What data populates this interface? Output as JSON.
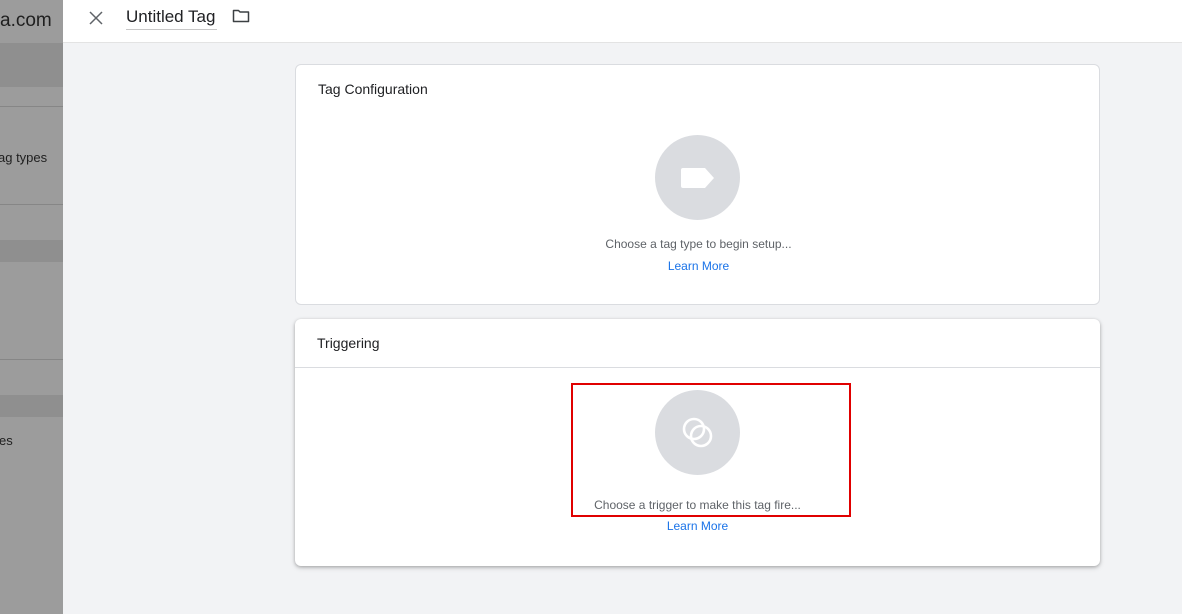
{
  "background": {
    "domain_fragment": "a.com",
    "sidebar_text_1": "ag types",
    "sidebar_text_2": "es"
  },
  "header": {
    "title": "Untitled Tag"
  },
  "tag_configuration": {
    "title": "Tag Configuration",
    "hint": "Choose a tag type to begin setup...",
    "learn_more": "Learn More"
  },
  "triggering": {
    "title": "Triggering",
    "hint": "Choose a trigger to make this tag fire...",
    "learn_more": "Learn More"
  },
  "icons": {
    "close": "close-icon",
    "folder": "folder-icon",
    "tag": "tag-icon",
    "trigger": "trigger-icon"
  },
  "colors": {
    "accent": "#1a73e8",
    "highlight": "#e00000",
    "icon_circle": "#dadce0"
  }
}
